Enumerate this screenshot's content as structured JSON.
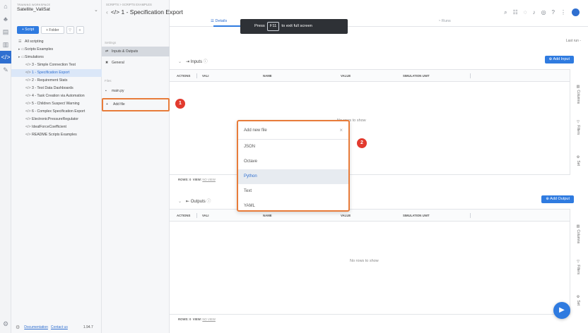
{
  "rail": {
    "icons": [
      "home-icon",
      "hierarchy-icon",
      "clipboard-icon",
      "chart-icon",
      "code-icon",
      "pencil-icon"
    ],
    "settings_icon": "gear-icon"
  },
  "workspace": {
    "caption": "TRAINING WORKSPACE",
    "name": "Satellite_ValiSat"
  },
  "project": {
    "script_button": "+ Script",
    "folder_button": "+ Folder",
    "filter_icon": "▽",
    "collapse_icon": "≡",
    "tree": [
      {
        "label": "All scripting",
        "icon": "☰",
        "level": 0
      },
      {
        "label": "Scripts Examples",
        "icon": "▸ ▭",
        "level": 0
      },
      {
        "label": "Simulations",
        "icon": "▸ ▭",
        "level": 0
      },
      {
        "label": "3 - Simple Connection Test",
        "icon": "</>",
        "level": 1
      },
      {
        "label": "1 - Specification Export",
        "icon": "</>",
        "level": 1,
        "selected": true
      },
      {
        "label": "2 - Requirement Stats",
        "icon": "</>",
        "level": 1
      },
      {
        "label": "3 - Test Data Dashboards",
        "icon": "</>",
        "level": 1
      },
      {
        "label": "4 - Task Creation via Automation",
        "icon": "</>",
        "level": 1
      },
      {
        "label": "5 - Children Suspect Warning",
        "icon": "</>",
        "level": 1
      },
      {
        "label": "6 - Complex Specification Export",
        "icon": "</>",
        "level": 1
      },
      {
        "label": "ElectronicPressureRegulator",
        "icon": "</>",
        "level": 1
      },
      {
        "label": "IdealForceCoefficient",
        "icon": "</>",
        "level": 1
      },
      {
        "label": "README Scripts Examples",
        "icon": "</>",
        "level": 1
      }
    ],
    "footer": {
      "documentation": "Documentation",
      "contact": "Contact us",
      "version": "1.94.7"
    }
  },
  "header": {
    "breadcrumb": "SCRIPTS > SCRIPTS EXAMPLES",
    "title": "</> 1 - Specification Export",
    "back_icon": "‹"
  },
  "settings": {
    "settings_heading": "Settings",
    "inputs_outputs": "Inputs & Outputs",
    "general": "General",
    "files_heading": "Files",
    "main_file": "main.py",
    "add_file": "Add file"
  },
  "tabs": {
    "details": "Details",
    "runs": "Runs"
  },
  "toast": {
    "prefix": "Press",
    "key": "F11",
    "suffix": "to exit full screen"
  },
  "last_run": "Last run -",
  "inputs": {
    "title": "Inputs",
    "add_button": "Add Input",
    "columns": [
      "ACTIONS",
      "VALI",
      "NAME",
      "VALUE",
      "SIMULATION UNIT"
    ],
    "no_rows": "No rows to show",
    "footer_rows": "ROWS: 0",
    "footer_view": "VIEW:",
    "footer_view_value": "NO VIEW"
  },
  "outputs": {
    "title": "Outputs",
    "add_button": "Add Output",
    "columns": [
      "ACTIONS",
      "VALI",
      "NAME",
      "VALUE",
      "SIMULATION UNIT"
    ],
    "no_rows": "No rows to show",
    "footer_rows": "ROWS: 0",
    "footer_view": "VIEW:",
    "footer_view_value": "NO VIEW"
  },
  "side_panel": {
    "columns": "Columns",
    "filters": "Filters",
    "settings": "Set"
  },
  "dropdown": {
    "title": "Add new file",
    "options": [
      "JSON",
      "Octave",
      "Python",
      "Text",
      "YAML"
    ],
    "active": "Python"
  },
  "annotations": {
    "step1": "1",
    "step2": "2"
  },
  "colors": {
    "accent": "#2f7be0",
    "highlight": "#e87c3a",
    "badge": "#e23a2e"
  }
}
